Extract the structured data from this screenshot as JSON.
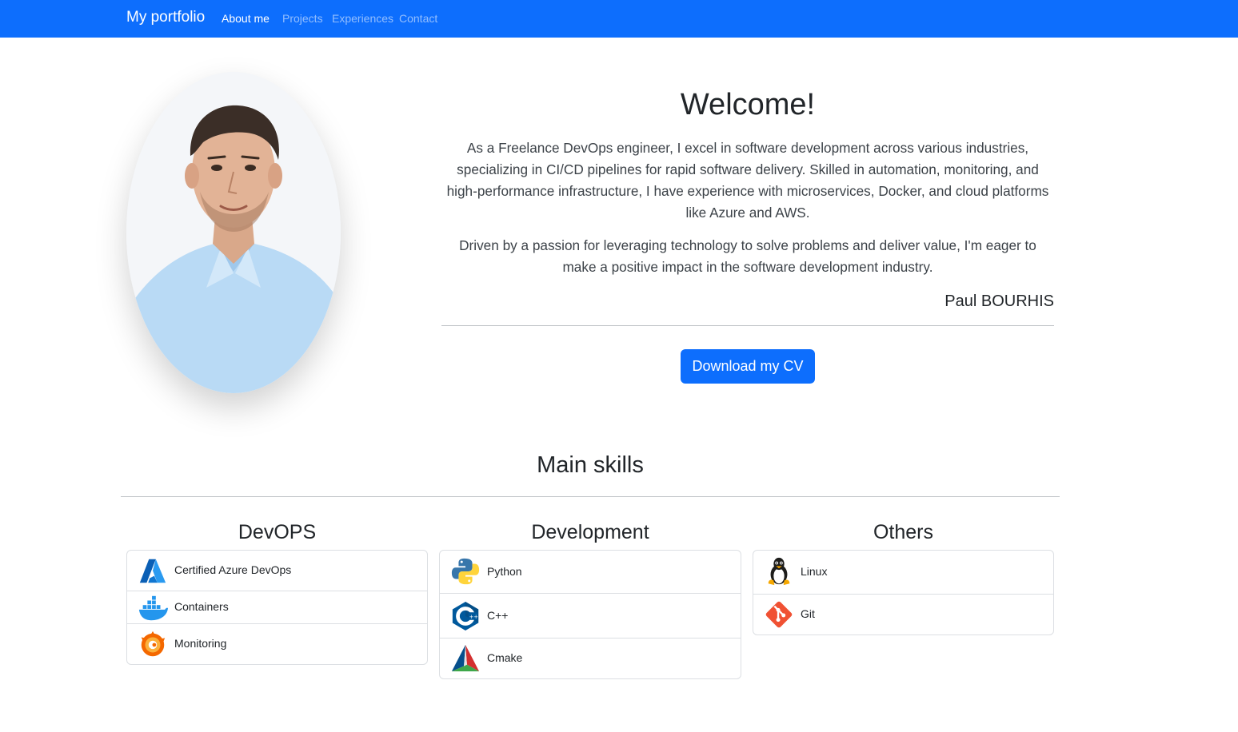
{
  "navbar": {
    "brand": "My portfolio",
    "links": [
      {
        "label": "About me"
      },
      {
        "label": "Projects"
      },
      {
        "label": "Experiences"
      },
      {
        "label": "Contact"
      }
    ]
  },
  "hero": {
    "title": "Welcome!",
    "paragraphs": [
      "As a Freelance DevOps engineer, I excel in software development across various industries, specializing in CI/CD pipelines for rapid software delivery. Skilled in automation, monitoring, and high-performance infrastructure, I have experience with microservices, Docker, and cloud platforms like Azure and AWS.",
      "Driven by a passion for leveraging technology to solve problems and deliver value, I'm eager to make a positive impact in the software development industry."
    ],
    "signature": "Paul BOURHIS",
    "cv_button": "Download my CV"
  },
  "skills": {
    "title": "Main skills",
    "columns": [
      {
        "title": "DevOPS",
        "items": [
          {
            "label": "Certified Azure DevOps",
            "icon": "azure-icon"
          },
          {
            "label": "Containers",
            "icon": "docker-icon"
          },
          {
            "label": "Monitoring",
            "icon": "grafana-icon"
          }
        ]
      },
      {
        "title": "Development",
        "items": [
          {
            "label": "Python",
            "icon": "python-icon"
          },
          {
            "label": "C++",
            "icon": "cpp-icon"
          },
          {
            "label": "Cmake",
            "icon": "cmake-icon"
          }
        ]
      },
      {
        "title": "Others",
        "items": [
          {
            "label": "Linux",
            "icon": "linux-icon"
          },
          {
            "label": "Git",
            "icon": "git-icon"
          }
        ]
      }
    ]
  },
  "colors": {
    "primary": "#0d6efd",
    "text": "#212529",
    "border": "#dcdfe3"
  }
}
